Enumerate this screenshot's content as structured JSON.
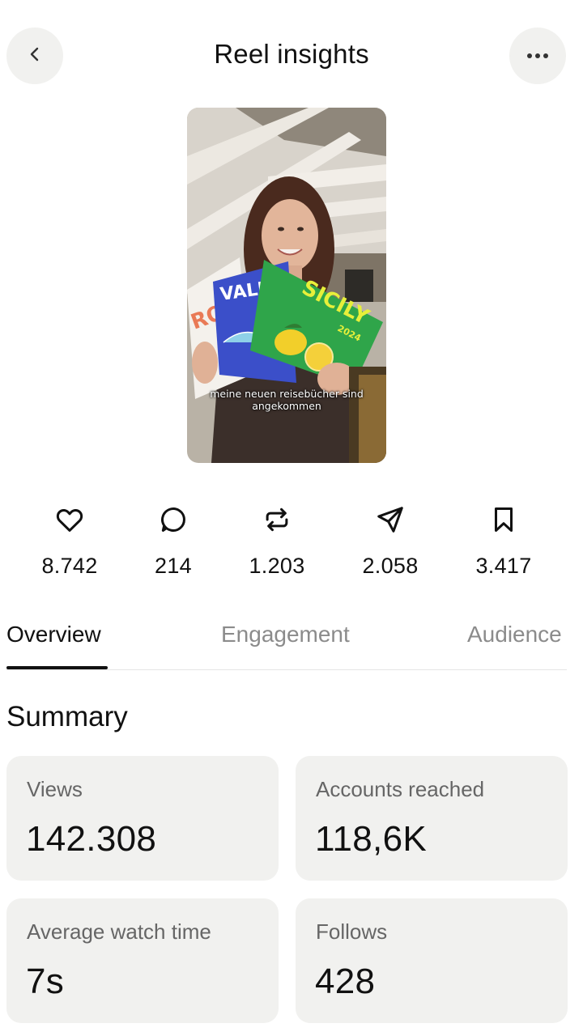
{
  "header": {
    "title": "Reel insights",
    "back_icon": "chevron-left-icon",
    "more_icon": "more-horizontal-icon"
  },
  "reel": {
    "caption": "meine neuen reisebücher sind angekommen",
    "book_left": "VALEN",
    "book_right": "SICILY",
    "book_right_year": "2024",
    "book_back": "ROM"
  },
  "metrics": [
    {
      "icon": "heart-icon",
      "value": "8.742"
    },
    {
      "icon": "comment-icon",
      "value": "214"
    },
    {
      "icon": "repost-icon",
      "value": "1.203"
    },
    {
      "icon": "share-icon",
      "value": "2.058"
    },
    {
      "icon": "bookmark-icon",
      "value": "3.417"
    }
  ],
  "tabs": [
    {
      "label": "Overview",
      "active": true
    },
    {
      "label": "Engagement",
      "active": false
    },
    {
      "label": "Audience",
      "active": false
    }
  ],
  "summary": {
    "title": "Summary",
    "cards": [
      {
        "label": "Views",
        "value": "142.308"
      },
      {
        "label": "Accounts reached",
        "value": "118,6K"
      },
      {
        "label": "Average watch time",
        "value": "7s"
      },
      {
        "label": "Follows",
        "value": "428"
      }
    ]
  },
  "colors": {
    "card_bg": "#f1f1ef",
    "text_primary": "#111111",
    "text_secondary": "#666666",
    "tab_inactive": "#8b8b8b"
  }
}
